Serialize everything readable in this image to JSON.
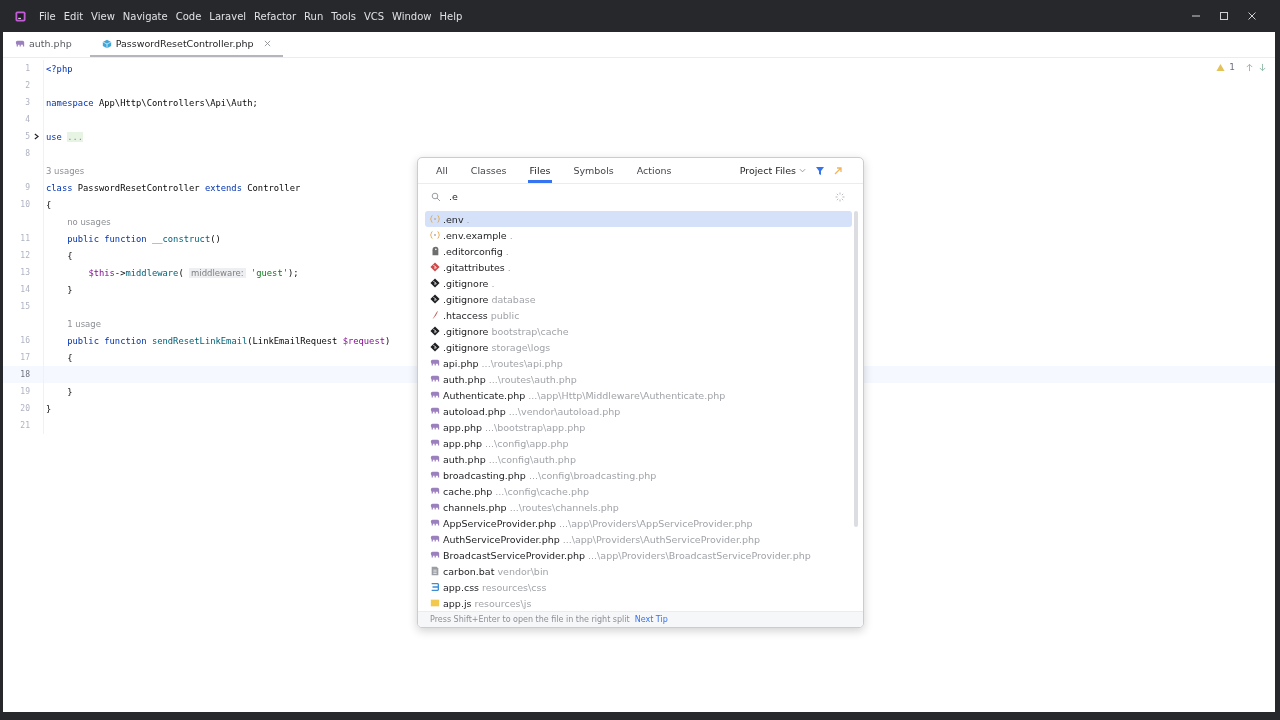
{
  "menu": [
    "File",
    "Edit",
    "View",
    "Navigate",
    "Code",
    "Laravel",
    "Refactor",
    "Run",
    "Tools",
    "VCS",
    "Window",
    "Help"
  ],
  "tabs": [
    {
      "label": "auth.php",
      "kind": "php",
      "selected": false
    },
    {
      "label": "PasswordResetController.php",
      "kind": "class",
      "selected": true
    }
  ],
  "editor": {
    "warnings": "1",
    "lines": [
      {
        "kind": "code",
        "number": "1",
        "current": false,
        "tokens": [
          {
            "kind": "kw",
            "s": "<?php"
          }
        ]
      },
      {
        "kind": "code",
        "number": "2",
        "current": false
      },
      {
        "kind": "code",
        "number": "3",
        "current": false,
        "tokens": [
          {
            "kind": "kw",
            "s": "namespace "
          },
          {
            "kind": "plain",
            "s": "App\\Http\\Controllers\\Api\\Auth;"
          }
        ]
      },
      {
        "kind": "code",
        "number": "4",
        "current": false
      },
      {
        "kind": "folded",
        "number": "5",
        "current": false,
        "tokens": [
          {
            "kind": "kw",
            "s": "use "
          },
          {
            "kind": "fold",
            "s": "..."
          }
        ]
      },
      {
        "kind": "code",
        "number": "8",
        "current": false
      },
      {
        "kind": "hint",
        "text": "3 usages"
      },
      {
        "kind": "code",
        "number": "9",
        "current": false,
        "tokens": [
          {
            "kind": "kw",
            "s": "class "
          },
          {
            "kind": "plain",
            "s": "PasswordResetController "
          },
          {
            "kind": "kw",
            "s": "extends "
          },
          {
            "kind": "plain",
            "s": "Controller"
          }
        ]
      },
      {
        "kind": "code",
        "number": "10",
        "current": false,
        "tokens": [
          {
            "kind": "plain",
            "s": "{"
          }
        ]
      },
      {
        "kind": "hint",
        "text": "no usages"
      },
      {
        "kind": "code",
        "number": "11",
        "current": false,
        "tokens": [
          {
            "kind": "kw",
            "s": "    public function "
          },
          {
            "kind": "fn",
            "s": "__construct"
          },
          {
            "kind": "plain",
            "s": "()"
          }
        ]
      },
      {
        "kind": "code",
        "number": "12",
        "current": false,
        "tokens": [
          {
            "kind": "plain",
            "s": "    {"
          }
        ]
      },
      {
        "kind": "code",
        "number": "13",
        "current": false,
        "tokens": [
          {
            "kind": "var",
            "s": "        $this"
          },
          {
            "kind": "plain",
            "s": "->"
          },
          {
            "kind": "fn",
            "s": "middleware"
          },
          {
            "kind": "plain",
            "s": "( "
          },
          {
            "kind": "param",
            "s": "middleware:"
          },
          {
            "kind": "str",
            "s": " 'guest'"
          },
          {
            "kind": "plain",
            "s": ");"
          }
        ]
      },
      {
        "kind": "code",
        "number": "14",
        "current": false,
        "tokens": [
          {
            "kind": "plain",
            "s": "    }"
          }
        ]
      },
      {
        "kind": "code",
        "number": "15",
        "current": false
      },
      {
        "kind": "hint",
        "text": "1 usage"
      },
      {
        "kind": "code",
        "number": "16",
        "current": false,
        "tokens": [
          {
            "kind": "kw",
            "s": "    public function "
          },
          {
            "kind": "fn",
            "s": "sendResetLinkEmail"
          },
          {
            "kind": "plain",
            "s": "(LinkEmailRequest "
          },
          {
            "kind": "var",
            "s": "$request"
          },
          {
            "kind": "plain",
            "s": ")"
          }
        ]
      },
      {
        "kind": "code",
        "number": "17",
        "current": false,
        "tokens": [
          {
            "kind": "plain",
            "s": "    {"
          }
        ]
      },
      {
        "kind": "code",
        "number": "18",
        "current": true
      },
      {
        "kind": "code",
        "number": "19",
        "current": false,
        "tokens": [
          {
            "kind": "plain",
            "s": "    }"
          }
        ]
      },
      {
        "kind": "code",
        "number": "20",
        "current": false,
        "tokens": [
          {
            "kind": "plain",
            "s": "}"
          }
        ]
      },
      {
        "kind": "code",
        "number": "21",
        "current": false
      }
    ]
  },
  "search_popup": {
    "tabs": [
      {
        "label": "All",
        "selected": false
      },
      {
        "label": "Classes",
        "selected": false
      },
      {
        "label": "Files",
        "selected": true
      },
      {
        "label": "Symbols",
        "selected": false
      },
      {
        "label": "Actions",
        "selected": false
      }
    ],
    "scope": "Project Files",
    "query": ".e",
    "results": [
      {
        "kind": "env",
        "name": ".env",
        "path": ".",
        "selected": true
      },
      {
        "kind": "env",
        "name": ".env.example",
        "path": ".",
        "selected": false
      },
      {
        "kind": "config",
        "name": ".editorconfig",
        "path": ".",
        "selected": false
      },
      {
        "kind": "attributes",
        "name": ".gitattributes",
        "path": ".",
        "selected": false
      },
      {
        "kind": "git",
        "name": ".gitignore",
        "path": ".",
        "selected": false
      },
      {
        "kind": "git",
        "name": ".gitignore",
        "path": "database",
        "selected": false
      },
      {
        "kind": "htaccess",
        "name": ".htaccess",
        "path": "public",
        "selected": false
      },
      {
        "kind": "git",
        "name": ".gitignore",
        "path": "bootstrap\\cache",
        "selected": false
      },
      {
        "kind": "git",
        "name": ".gitignore",
        "path": "storage\\logs",
        "selected": false
      },
      {
        "kind": "php",
        "name": "api.php",
        "path": "...\\routes\\api.php",
        "selected": false
      },
      {
        "kind": "php",
        "name": "auth.php",
        "path": "...\\routes\\auth.php",
        "selected": false
      },
      {
        "kind": "php",
        "name": "Authenticate.php",
        "path": "...\\app\\Http\\Middleware\\Authenticate.php",
        "selected": false
      },
      {
        "kind": "php",
        "name": "autoload.php",
        "path": "...\\vendor\\autoload.php",
        "selected": false
      },
      {
        "kind": "php",
        "name": "app.php",
        "path": "...\\bootstrap\\app.php",
        "selected": false
      },
      {
        "kind": "php",
        "name": "app.php",
        "path": "...\\config\\app.php",
        "selected": false
      },
      {
        "kind": "php",
        "name": "auth.php",
        "path": "...\\config\\auth.php",
        "selected": false
      },
      {
        "kind": "php",
        "name": "broadcasting.php",
        "path": "...\\config\\broadcasting.php",
        "selected": false
      },
      {
        "kind": "php",
        "name": "cache.php",
        "path": "...\\config\\cache.php",
        "selected": false
      },
      {
        "kind": "php",
        "name": "channels.php",
        "path": "...\\routes\\channels.php",
        "selected": false
      },
      {
        "kind": "php",
        "name": "AppServiceProvider.php",
        "path": "...\\app\\Providers\\AppServiceProvider.php",
        "selected": false
      },
      {
        "kind": "php",
        "name": "AuthServiceProvider.php",
        "path": "...\\app\\Providers\\AuthServiceProvider.php",
        "selected": false
      },
      {
        "kind": "php",
        "name": "BroadcastServiceProvider.php",
        "path": "...\\app\\Providers\\BroadcastServiceProvider.php",
        "selected": false
      },
      {
        "kind": "bat",
        "name": "carbon.bat",
        "path": "vendor\\bin",
        "selected": false
      },
      {
        "kind": "css",
        "name": "app.css",
        "path": "resources\\css",
        "selected": false
      },
      {
        "kind": "js",
        "name": "app.js",
        "path": "resources\\js",
        "selected": false
      }
    ],
    "tip": "Press Shift+Enter to open the file in the right split",
    "tip_link": "Next Tip"
  }
}
